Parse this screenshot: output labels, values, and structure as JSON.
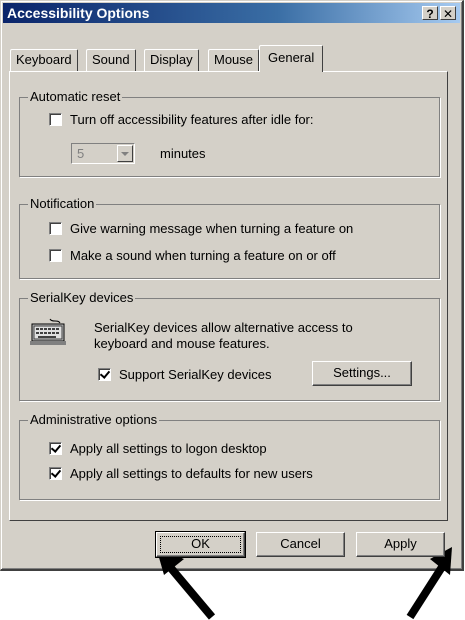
{
  "window": {
    "title": "Accessibility Options",
    "help_glyph": "?",
    "close_glyph": "✕"
  },
  "tabs": [
    {
      "label": "Keyboard"
    },
    {
      "label": "Sound"
    },
    {
      "label": "Display"
    },
    {
      "label": "Mouse"
    },
    {
      "label": "General",
      "active": true
    }
  ],
  "automatic_reset": {
    "title": "Automatic reset",
    "checkbox_label": "Turn off accessibility features after idle for:",
    "checked": false,
    "idle_value": "5",
    "unit_label": "minutes"
  },
  "notification": {
    "title": "Notification",
    "items": [
      {
        "label": "Give warning message when turning a feature on",
        "checked": false
      },
      {
        "label": "Make a sound when turning a feature on or off",
        "checked": false
      }
    ]
  },
  "serialkey": {
    "title": "SerialKey devices",
    "description_line1": "SerialKey devices allow alternative access to",
    "description_line2": "keyboard and mouse features.",
    "support_label": "Support SerialKey devices",
    "support_checked": true,
    "settings_button": "Settings...",
    "icon": "keyboard-icon"
  },
  "admin": {
    "title": "Administrative options",
    "items": [
      {
        "label": "Apply all settings to logon desktop",
        "checked": true
      },
      {
        "label": "Apply all settings to defaults for new users",
        "checked": true
      }
    ]
  },
  "footer": {
    "ok": "OK",
    "cancel": "Cancel",
    "apply": "Apply"
  },
  "colors": {
    "face": "#d4d0c8",
    "title_start": "#0a246a",
    "title_end": "#a6caf0"
  }
}
